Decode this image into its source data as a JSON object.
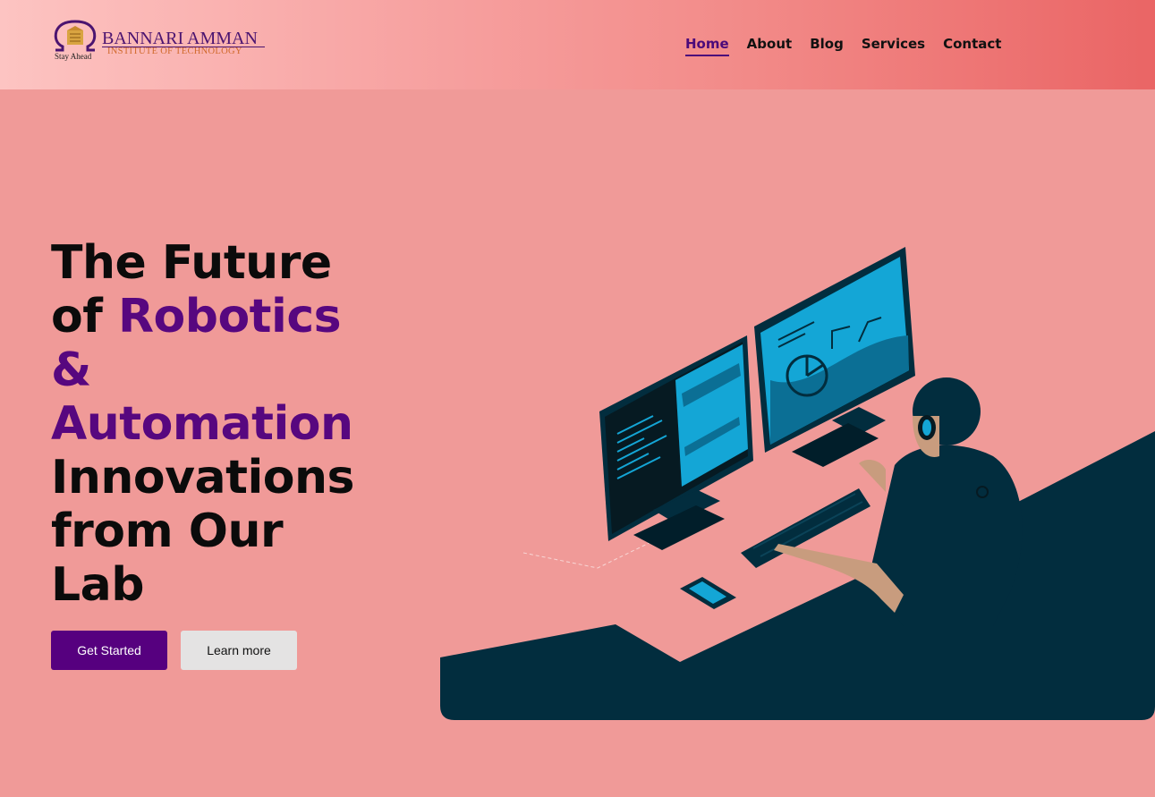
{
  "header": {
    "logo": {
      "name": "BANNARI AMMAN",
      "subtitle": "INSTITUTE OF TECHNOLOGY",
      "tagline": "Stay Ahead"
    },
    "nav": [
      {
        "label": "Home",
        "active": true
      },
      {
        "label": "About",
        "active": false
      },
      {
        "label": "Blog",
        "active": false
      },
      {
        "label": "Services",
        "active": false
      },
      {
        "label": "Contact",
        "active": false
      }
    ]
  },
  "hero": {
    "title_line1": "The Future",
    "title_of": "of ",
    "title_accent1": "Robotics",
    "title_accent2": "&",
    "title_accent3": "Automation",
    "title_line5": "Innovations",
    "title_line6": "from Our",
    "title_line7": "Lab",
    "primary_button": "Get Started",
    "secondary_button": "Learn more"
  },
  "colors": {
    "accent": "#56007f",
    "background": "#f09a98",
    "illustration_dark": "#022d3e",
    "illustration_cyan": "#12a8d8"
  },
  "icons": [
    "logo-mark-icon"
  ]
}
